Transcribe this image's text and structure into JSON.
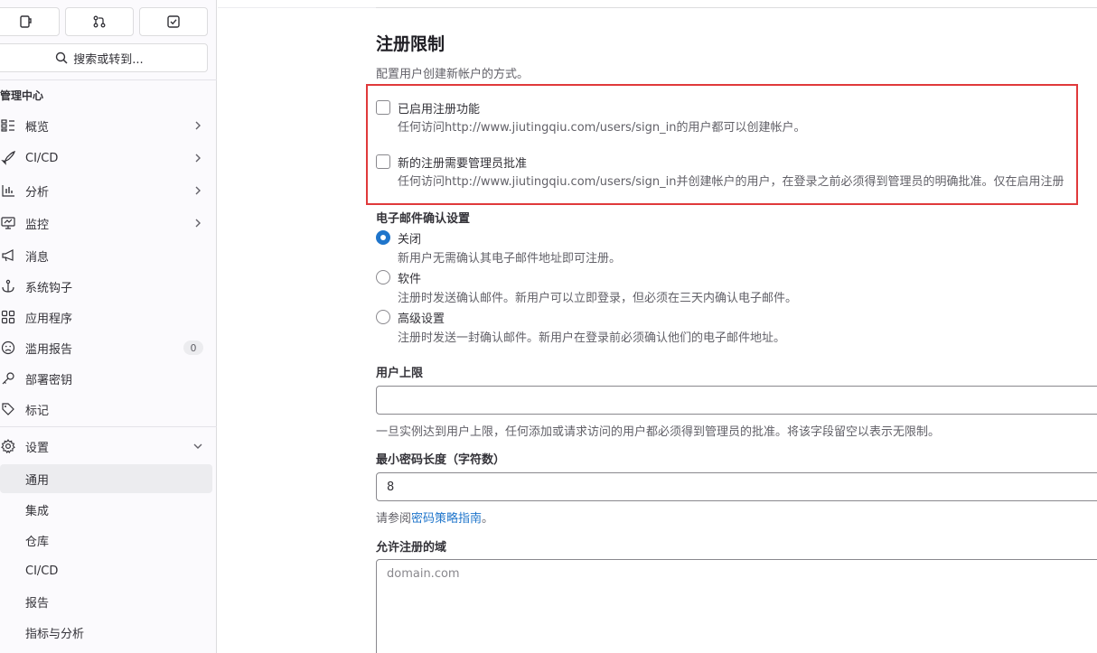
{
  "sidebar": {
    "search_placeholder": "搜索或转到...",
    "section_title": "管理中心",
    "items": [
      {
        "label": "概览",
        "icon": "overview-icon"
      },
      {
        "label": "CI/CD",
        "icon": "rocket-icon"
      },
      {
        "label": "分析",
        "icon": "chart-icon"
      },
      {
        "label": "监控",
        "icon": "monitor-icon"
      },
      {
        "label": "消息",
        "icon": "megaphone-icon"
      },
      {
        "label": "系统钩子",
        "icon": "anchor-icon"
      },
      {
        "label": "应用程序",
        "icon": "apps-icon"
      },
      {
        "label": "滥用报告",
        "icon": "abuse-icon",
        "badge": "0"
      },
      {
        "label": "部署密钥",
        "icon": "key-icon"
      },
      {
        "label": "标记",
        "icon": "labels-icon"
      },
      {
        "label": "设置",
        "icon": "settings-icon"
      }
    ],
    "settings_children": [
      "通用",
      "集成",
      "仓库",
      "CI/CD",
      "报告",
      "指标与分析"
    ]
  },
  "main": {
    "title": "注册限制",
    "description": "配置用户创建新帐户的方式。",
    "signup_enabled": {
      "label": "已启用注册功能",
      "help": "任何访问http://www.jiutingqiu.com/users/sign_in的用户都可以创建帐户。"
    },
    "admin_approval": {
      "label": "新的注册需要管理员批准",
      "help": "任何访问http://www.jiutingqiu.com/users/sign_in并创建帐户的用户，在登录之前必须得到管理员的明确批准。仅在启用注册"
    },
    "email_confirm": {
      "label": "电子邮件确认设置",
      "options": [
        {
          "label": "关闭",
          "help": "新用户无需确认其电子邮件地址即可注册。",
          "selected": true
        },
        {
          "label": "软件",
          "help": "注册时发送确认邮件。新用户可以立即登录，但必须在三天内确认电子邮件。",
          "selected": false
        },
        {
          "label": "高级设置",
          "help": "注册时发送一封确认邮件。新用户在登录前必须确认他们的电子邮件地址。",
          "selected": false
        }
      ]
    },
    "user_cap": {
      "label": "用户上限",
      "value": "",
      "help": "一旦实例达到用户上限，任何添加或请求访问的用户都必须得到管理员的批准。将该字段留空以表示无限制。"
    },
    "min_password": {
      "label": "最小密码长度（字符数）",
      "value": "8",
      "help_prefix": "请参阅",
      "help_link": "密码策略指南",
      "help_suffix": "。"
    },
    "allowed_domains": {
      "label": "允许注册的域",
      "placeholder": "domain.com"
    }
  },
  "colors": {
    "accent": "#1f75cb",
    "highlight_border": "#e0393b"
  }
}
